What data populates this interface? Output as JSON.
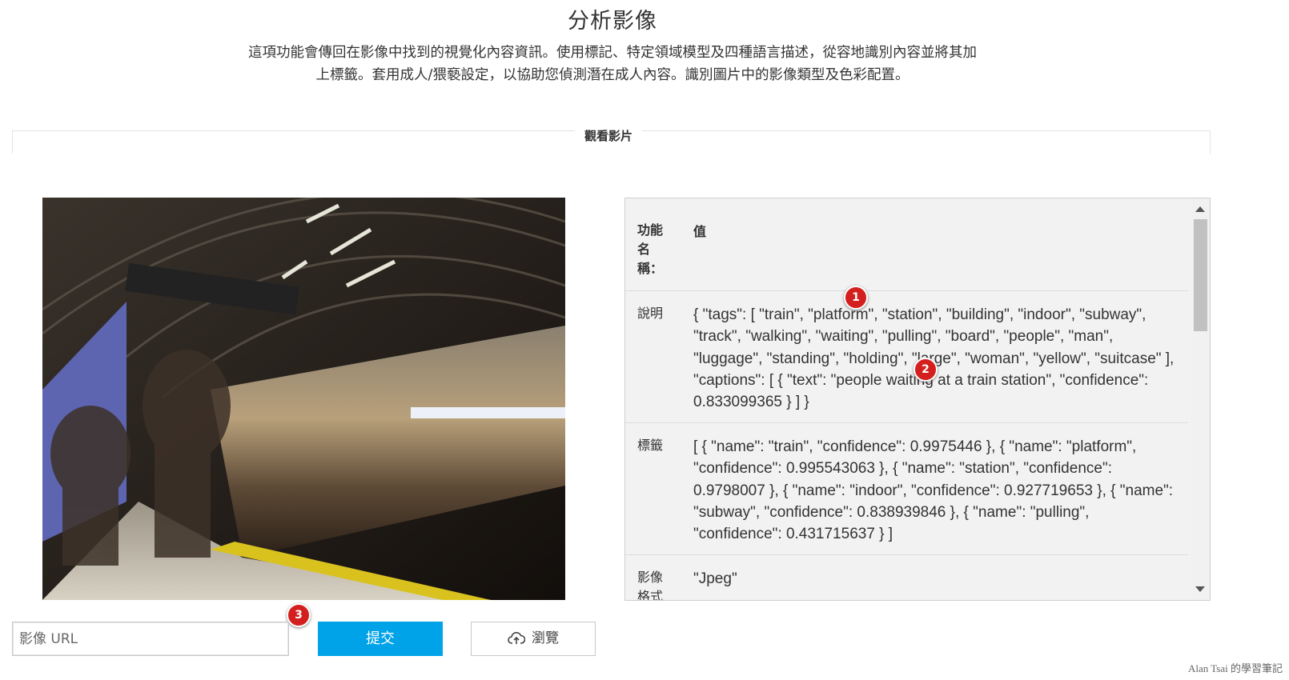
{
  "header": {
    "title": "分析影像",
    "description_line1": "這項功能會傳回在影像中找到的視覺化內容資訊。使用標記、特定領域模型及四種語言描述，從容地識別內容並將其加",
    "description_line2": "上標籤。套用成人/猥褻設定，以協助您偵測潛在成人內容。識別圖片中的影像類型及色彩配置。"
  },
  "section": {
    "label": "觀看影片"
  },
  "preview": {
    "image_icon": "subway-train-photo"
  },
  "results": {
    "header_key": "功能名稱：",
    "header_value": "值",
    "rows": [
      {
        "key": "說明",
        "value": "{ \"tags\": [ \"train\", \"platform\", \"station\", \"building\", \"indoor\", \"subway\", \"track\", \"walking\", \"waiting\", \"pulling\", \"board\", \"people\", \"man\", \"luggage\", \"standing\", \"holding\", \"large\", \"woman\", \"yellow\", \"suitcase\" ], \"captions\": [ { \"text\": \"people waiting at a train station\", \"confidence\": 0.833099365 } ] }"
      },
      {
        "key": "標籤",
        "value": "[ { \"name\": \"train\", \"confidence\": 0.9975446 }, { \"name\": \"platform\", \"confidence\": 0.995543063 }, { \"name\": \"station\", \"confidence\": 0.9798007 }, { \"name\": \"indoor\", \"confidence\": 0.927719653 }, { \"name\": \"subway\", \"confidence\": 0.838939846 }, { \"name\": \"pulling\", \"confidence\": 0.431715637 } ]"
      },
      {
        "key": "影像格式",
        "value": "\"Jpeg\""
      }
    ]
  },
  "annotations": [
    "1",
    "2",
    "3"
  ],
  "form": {
    "url_placeholder": "影像 URL",
    "submit_label": "提交",
    "browse_label": "瀏覽",
    "browse_icon": "cloud-upload-icon"
  },
  "watermark": "Alan Tsai 的學習筆記",
  "colors": {
    "accent": "#00a2e8",
    "badge": "#d41f1f",
    "panel_bg": "#f2f2f2"
  }
}
